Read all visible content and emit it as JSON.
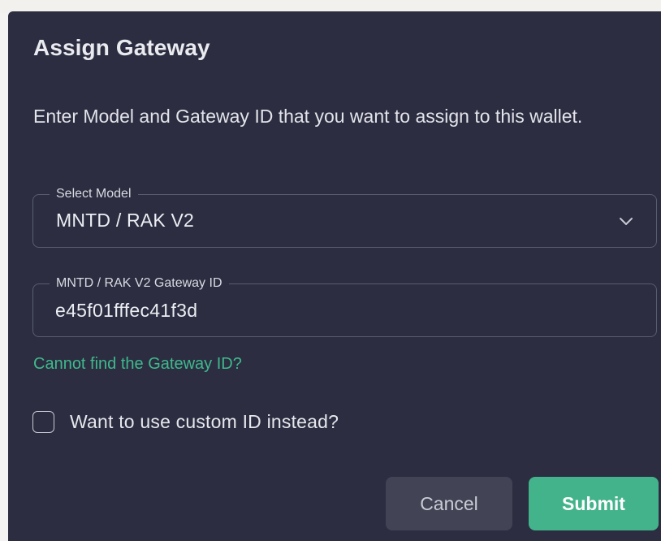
{
  "dialog": {
    "title": "Assign Gateway",
    "description": "Enter Model and Gateway ID that you want to assign to this wallet."
  },
  "model_select": {
    "label": "Select Model",
    "value": "MNTD / RAK V2",
    "icon": "chevron-down-icon"
  },
  "gateway_id_field": {
    "label": "MNTD / RAK V2 Gateway ID",
    "value": "e45f01fffec41f3d"
  },
  "help_link": {
    "label": "Cannot find the Gateway ID?"
  },
  "custom_id_checkbox": {
    "label": "Want to use custom ID instead?",
    "checked": false
  },
  "buttons": {
    "cancel_label": "Cancel",
    "submit_label": "Submit"
  },
  "colors": {
    "dialog_background": "#2c2d40",
    "accent": "#42b38b",
    "link": "#3fb98d",
    "cancel_background": "#424456"
  }
}
